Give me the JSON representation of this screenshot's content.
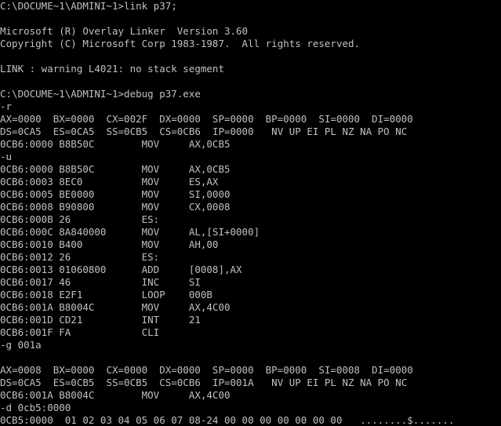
{
  "console": {
    "lines": [
      "C:\\DOCUME~1\\ADMINI~1>link p37;",
      "",
      "Microsoft (R) Overlay Linker  Version 3.60",
      "Copyright (C) Microsoft Corp 1983-1987.  All rights reserved.",
      "",
      "LINK : warning L4021: no stack segment",
      "",
      "C:\\DOCUME~1\\ADMINI~1>debug p37.exe",
      "-r",
      "AX=0000  BX=0000  CX=002F  DX=0000  SP=0000  BP=0000  SI=0000  DI=0000",
      "DS=0CA5  ES=0CA5  SS=0CB5  CS=0CB6  IP=0000   NV UP EI PL NZ NA PO NC",
      "0CB6:0000 B8B50C        MOV     AX,0CB5",
      "-u",
      "0CB6:0000 B8B50C        MOV     AX,0CB5",
      "0CB6:0003 8EC0          MOV     ES,AX",
      "0CB6:0005 BE0000        MOV     SI,0000",
      "0CB6:0008 B90800        MOV     CX,0008",
      "0CB6:000B 26            ES:",
      "0CB6:000C 8A840000      MOV     AL,[SI+0000]",
      "0CB6:0010 B400          MOV     AH,00",
      "0CB6:0012 26            ES:",
      "0CB6:0013 01060800      ADD     [0008],AX",
      "0CB6:0017 46            INC     SI",
      "0CB6:0018 E2F1          LOOP    000B",
      "0CB6:001A B8004C        MOV     AX,4C00",
      "0CB6:001D CD21          INT     21",
      "0CB6:001F FA            CLI",
      "-g 001a",
      "",
      "AX=0008  BX=0000  CX=0000  DX=0000  SP=0000  BP=0000  SI=0008  DI=0000",
      "DS=0CA5  ES=0CB5  SS=0CB5  CS=0CB6  IP=001A   NV UP EI PL NZ NA PO NC",
      "0CB6:001A B8004C        MOV     AX,4C00",
      "-d 0cb5:0000",
      "0CB5:0000  01 02 03 04 05 06 07 08-24 00 00 00 00 00 00 00   ........$......."
    ]
  },
  "colors": {
    "background": "#000000",
    "text": "#c0c0c0"
  }
}
